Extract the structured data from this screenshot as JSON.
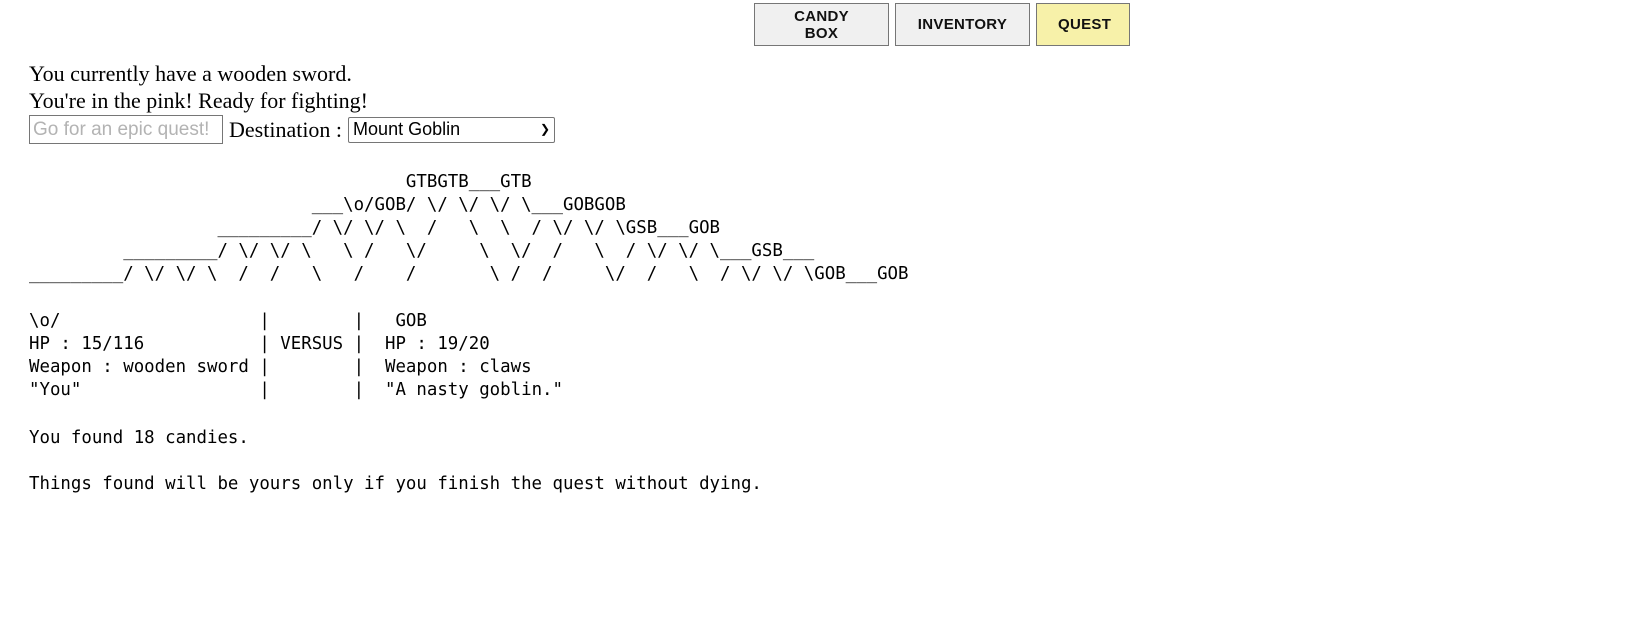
{
  "tabs": {
    "candy_box": "CANDY BOX",
    "inventory": "INVENTORY",
    "quest": "QUEST"
  },
  "status": {
    "weapon_line": "You currently have a wooden sword.",
    "health_line": "You're in the pink! Ready for fighting!"
  },
  "quest_controls": {
    "go_button": "Go for an epic quest!",
    "destination_label": "Destination :",
    "destination_selected": "Mount Goblin"
  },
  "scene_art": "                                    GTBGTB___GTB\n                           ___\\o/GOB/ \\/ \\/ \\/ \\___GOBGOB\n                  _________/ \\/ \\/ \\  /   \\  \\  / \\/ \\/ \\GSB___GOB\n         _________/ \\/ \\/ \\   \\ /   \\/     \\  \\/  /   \\  / \\/ \\/ \\___GSB___\n_________/ \\/ \\/ \\  /  /   \\   /    /       \\ /  /     \\/  /   \\  / \\/ \\/ \\GOB___GOB",
  "battle": {
    "player_avatar": "\\o/",
    "player_hp": "HP : 15/116",
    "player_weapon": "Weapon : wooden sword",
    "player_name": "\"You\"",
    "versus": "VERSUS",
    "enemy_avatar": "GOB",
    "enemy_hp": "HP : 19/20",
    "enemy_weapon": "Weapon : claws",
    "enemy_desc": "\"A nasty goblin.\""
  },
  "found_text": "You found 18 candies.",
  "note_text": "Things found will be yours only if you finish the quest without dying."
}
